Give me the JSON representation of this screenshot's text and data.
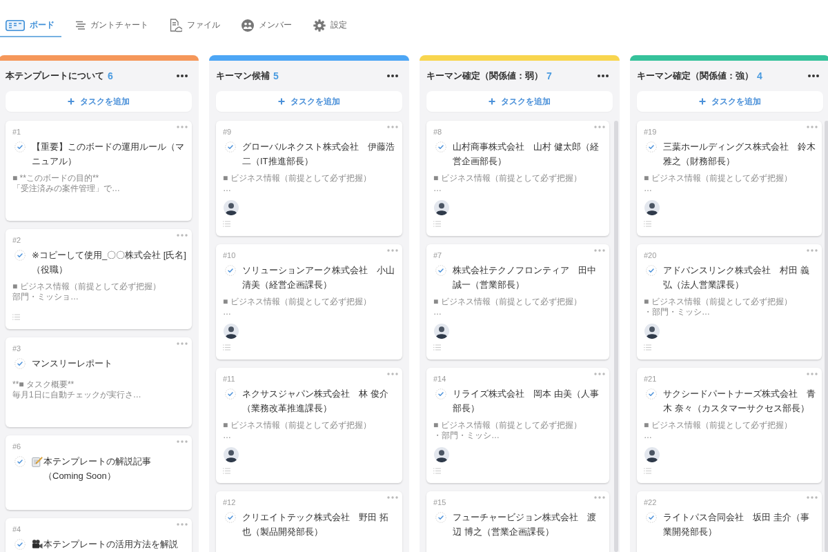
{
  "tabs": [
    {
      "label": "ボード",
      "selected": true
    },
    {
      "label": "ガントチャート",
      "selected": false
    },
    {
      "label": "ファイル",
      "selected": false
    },
    {
      "label": "メンバー",
      "selected": false
    },
    {
      "label": "設定",
      "selected": false
    }
  ],
  "columns": [
    {
      "title": "本テンプレートについて",
      "count": "6",
      "color": "#f5975a",
      "add_button": "タスクを追加",
      "cards": [
        {
          "kind": "plain",
          "number": "#1",
          "title": "【重要】このボードの運用ルール（マニュアル）",
          "description": [
            "■ **このボードの目的**",
            "「受注済みの案件管理」で…"
          ],
          "avatar": false,
          "list_icon": false
        },
        {
          "kind": "plain",
          "number": "#2",
          "title": "※コピーして使用_〇〇株式会社 [氏名]（役職）",
          "description": [
            "■ ビジネス情報（前提として必ず把握）",
            "部門・ミッショ…"
          ],
          "avatar": false,
          "list_icon": true
        },
        {
          "kind": "plain",
          "number": "#3",
          "title": "マンスリーレポート",
          "description": [
            "**■ タスク概要**",
            "毎月1日に自動チェックが実行さ…"
          ],
          "avatar": false,
          "list_icon": false
        },
        {
          "kind": "memo",
          "number": "#6",
          "title": "本テンプレートの解説記事（Coming Soon）",
          "avatar": false,
          "list_icon": false
        },
        {
          "kind": "video",
          "number": "#4",
          "title": "本テンプレートの活用方法を解説"
        }
      ]
    },
    {
      "title": "キーマン候補",
      "count": "5",
      "color": "#4da6f5",
      "add_button": "タスクを追加",
      "cards": [
        {
          "kind": "plain",
          "number": "#9",
          "title": "グローバルネクスト株式会社　伊藤浩二（IT推進部長）",
          "description": [
            "■ ビジネス情報（前提として必ず把握）",
            "…"
          ],
          "avatar": true,
          "list_icon": true
        },
        {
          "kind": "plain",
          "number": "#10",
          "title": "ソリューションアーク株式会社　小山清美（経営企画課長）",
          "description": [
            "■ ビジネス情報（前提として必ず把握）",
            "…"
          ],
          "avatar": true,
          "list_icon": true
        },
        {
          "kind": "plain",
          "number": "#11",
          "title": "ネクサスジャパン株式会社　林 俊介（業務改革推進課長）",
          "description": [
            "■ ビジネス情報（前提として必ず把握）",
            "…"
          ],
          "avatar": true,
          "list_icon": true
        },
        {
          "kind": "plain",
          "number": "#12",
          "title": "クリエイトテック株式会社　野田 拓也（製品開発部長）"
        }
      ]
    },
    {
      "title": "キーマン確定（関係値：弱）",
      "count": "7",
      "color": "#f8d54e",
      "add_button": "タスクを追加",
      "cards": [
        {
          "kind": "plain",
          "number": "#8",
          "title": "山村商事株式会社　山村 健太郎（経営企画部長）",
          "description": [
            "■ ビジネス情報（前提として必ず把握）",
            "…"
          ],
          "avatar": true,
          "list_icon": true
        },
        {
          "kind": "plain",
          "number": "#7",
          "title": "株式会社テクノフロンティア　田中誠一（営業部長）",
          "description": [
            "■ ビジネス情報（前提として必ず把握）",
            "…"
          ],
          "avatar": true,
          "list_icon": true
        },
        {
          "kind": "plain",
          "number": "#14",
          "title": "リライズ株式会社　岡本 由美（人事部長）",
          "description": [
            "■ ビジネス情報（前提として必ず把握）",
            "・部門・ミッシ…"
          ],
          "avatar": true,
          "list_icon": true
        },
        {
          "kind": "plain",
          "number": "#15",
          "title": "フューチャービジョン株式会社　渡辺 博之（営業企画課長）"
        }
      ]
    },
    {
      "title": "キーマン確定（関係値：強）",
      "count": "4",
      "color": "#36c29b",
      "add_button": "タスクを追加",
      "cards": [
        {
          "kind": "plain",
          "number": "#19",
          "title": "三葉ホールディングス株式会社　鈴木雅之（財務部長）",
          "description": [
            "■ ビジネス情報（前提として必ず把握）",
            "…"
          ],
          "avatar": true,
          "list_icon": true
        },
        {
          "kind": "plain",
          "number": "#20",
          "title": "アドバンスリンク株式会社　村田 義弘（法人営業課長）",
          "description": [
            "■ ビジネス情報（前提として必ず把握）",
            "・部門・ミッシ…"
          ],
          "avatar": true,
          "list_icon": true
        },
        {
          "kind": "plain",
          "number": "#21",
          "title": "サクシードパートナーズ株式会社　青木 奈々（カスタマーサクセス部長）",
          "description": [
            "■ ビジネス情報（前提として必ず把握）",
            "…"
          ],
          "avatar": true,
          "list_icon": true
        },
        {
          "kind": "plain",
          "number": "#22",
          "title": "ライトパス合同会社　坂田 圭介（事業開発部長）"
        }
      ]
    }
  ]
}
